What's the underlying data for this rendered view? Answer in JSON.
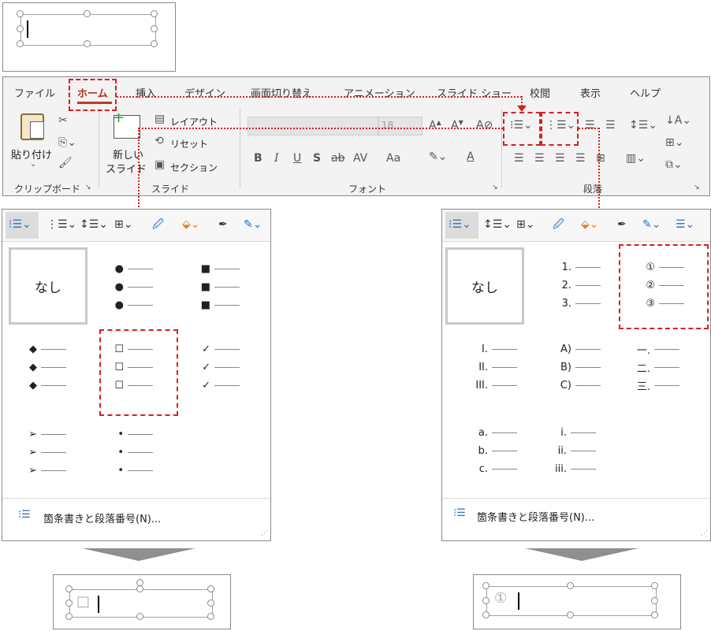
{
  "ribbon": {
    "tabs": [
      "ファイル",
      "ホーム",
      "挿入",
      "デザイン",
      "画面切り替え",
      "アニメーション",
      "スライド ショー",
      "校閲",
      "表示",
      "ヘルプ"
    ],
    "clipboard": {
      "paste": "貼り付け",
      "group": "クリップボード"
    },
    "slides": {
      "new_slide_1": "新しい",
      "new_slide_2": "スライド",
      "layout": "レイアウト",
      "reset": "リセット",
      "section": "セクション",
      "group": "スライド"
    },
    "font": {
      "size": "18",
      "group": "フォント",
      "bold": "B",
      "italic": "I",
      "underline": "U",
      "shadow": "S",
      "strike": "ab",
      "spacing": "AV",
      "case": "Aa",
      "color": "A"
    },
    "paragraph": {
      "group": "段落"
    }
  },
  "bullets_panel": {
    "none_label": "なし",
    "styles": [
      {
        "marker": "●"
      },
      {
        "marker": "■"
      },
      {
        "marker": "◆"
      },
      {
        "marker": "☐"
      },
      {
        "marker": "✓"
      },
      {
        "marker": "➢"
      },
      {
        "marker": "•"
      }
    ],
    "footer": "箇条書きと段落番号(N)..."
  },
  "numbering_panel": {
    "none_label": "なし",
    "styles": [
      {
        "markers": [
          "1.",
          "2.",
          "3."
        ]
      },
      {
        "markers": [
          "①",
          "②",
          "③"
        ]
      },
      {
        "markers": [
          "I.",
          "II.",
          "III."
        ]
      },
      {
        "markers": [
          "A)",
          "B)",
          "C)"
        ]
      },
      {
        "markers": [
          "一.",
          "二.",
          "三."
        ]
      },
      {
        "markers": [
          "a.",
          "b.",
          "c."
        ]
      },
      {
        "markers": [
          "i.",
          "ii.",
          "iii."
        ]
      }
    ],
    "footer": "箇条書きと段落番号(N)..."
  },
  "result_left": {
    "marker": "□"
  },
  "result_right": {
    "marker": "①"
  },
  "colors": {
    "accent_red": "#d62020",
    "ribbon_bg": "#f3f3f3",
    "home_underline": "#c0392b"
  }
}
